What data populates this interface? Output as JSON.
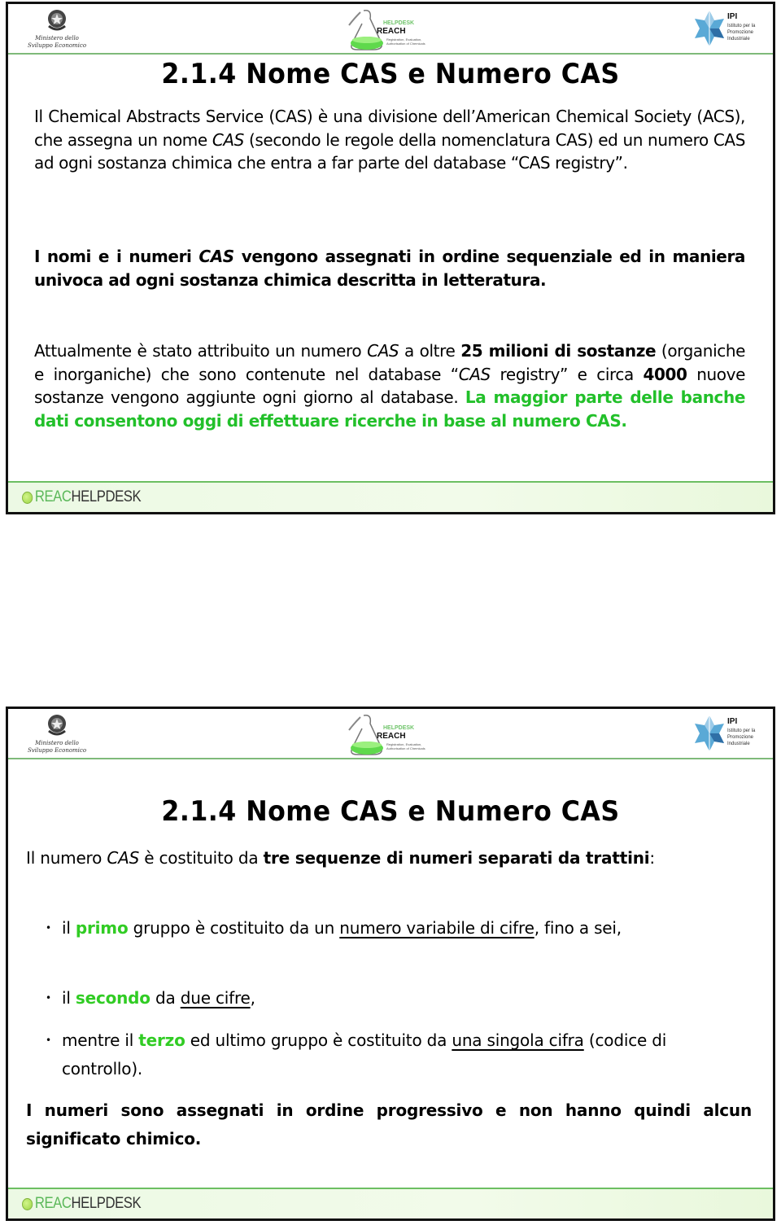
{
  "header": {
    "ministero_line1": "Ministero dello",
    "ministero_line2": "Sviluppo Economico",
    "reach_helpdesk": "HELPDESK",
    "reach_title": "REACH",
    "reach_sub1": "Registration, Evaluation,",
    "reach_sub2": "Authorisation of Chemicals",
    "ipi_title": "IPI",
    "ipi_sub1": "Istituto per la",
    "ipi_sub2": "Promozione",
    "ipi_sub3": "Industriale"
  },
  "footer": {
    "logo_part1": "REAC",
    "logo_part2": "HELPDESK"
  },
  "colors": {
    "highlight_green": "#22c02a",
    "header_rule": "#7fba7a",
    "footer_rule": "#6cbf62"
  },
  "slide1": {
    "title": "2.1.4 Nome CAS e Numero CAS",
    "p1": {
      "a": "Il Chemical Abstracts Service (CAS) è una divisione dell’American Chemical Society (ACS), che assegna un nome ",
      "cas1": "CAS",
      "b": " (secondo le regole della nomenclatura CAS) ed un numero CAS ad ogni sostanza chimica che entra a far parte del database “CAS registry”."
    },
    "p2": {
      "a": "I nomi e i numeri ",
      "cas": "CAS",
      "b": " vengono assegnati in ordine sequenziale ed in maniera univoca ad ogni sostanza chimica descritta in letteratura."
    },
    "p3": {
      "a": "Attualmente è stato attribuito un numero ",
      "cas": "CAS",
      "b": " a oltre ",
      "bold1": "25 milioni di sostanze",
      "c": " (organiche e inorganiche) che sono contenute nel database “",
      "cas2": "CAS",
      "d": " registry” e circa ",
      "bold2": "4000",
      "e": " nuove sostanze vengono aggiunte ogni giorno al database. ",
      "green": "La maggior parte delle banche dati consentono oggi di effettuare ricerche in base al numero CAS."
    }
  },
  "slide2": {
    "title": "2.1.4 Nome CAS e Numero CAS",
    "intro": {
      "a": "Il numero ",
      "cas": "CAS",
      "b": " è costituito da ",
      "bold": "tre sequenze di numeri separati da trattini",
      "c": ":"
    },
    "bullets": [
      {
        "a": "il ",
        "green": "primo",
        "b": " gruppo è costituito da un ",
        "underline": "numero variabile di cifre",
        "c": ", fino a sei,"
      },
      {
        "a": "il ",
        "green": "secondo",
        "b": " da ",
        "underline": "due cifre",
        "c": ","
      },
      {
        "a": "mentre il ",
        "green": "terzo",
        "b": " ed ultimo gruppo è costituito da ",
        "underline": "una singola cifra",
        "c": " (codice di controllo)."
      }
    ],
    "closing": "I numeri sono assegnati in ordine progressivo e non hanno quindi alcun significato chimico."
  }
}
